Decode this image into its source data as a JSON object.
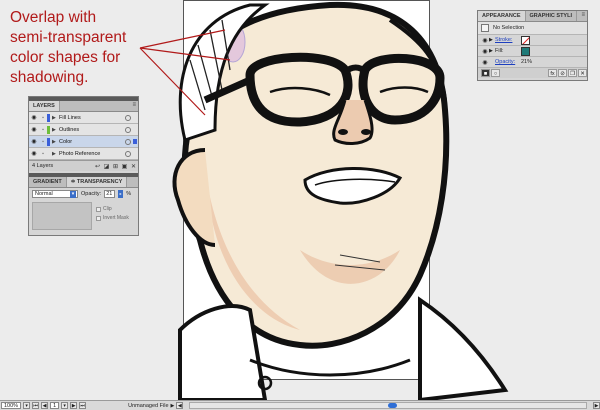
{
  "annotation": {
    "lines": [
      "Overlap with",
      "semi-transparent",
      "color shapes for",
      "shadowing."
    ],
    "color": "#b11a1a"
  },
  "layers_panel": {
    "tab": "LAYERS",
    "menu_icon": "panel-menu-icon",
    "layers": [
      {
        "name": "Fill Lines",
        "color": "#3a5fd9",
        "selected": false
      },
      {
        "name": "Outlines",
        "color": "#6fbf3a",
        "selected": false
      },
      {
        "name": "Color",
        "color": "#3a5fd9",
        "selected": true
      },
      {
        "name": "Photo Reference",
        "color": "#e4e4e4",
        "selected": false
      }
    ],
    "footer_label": "4 Layers"
  },
  "transparency_panel": {
    "tabs": [
      "GRADIENT",
      "≑ TRANSPARENCY"
    ],
    "blend_mode": "Normal",
    "opacity_label": "Opacity:",
    "opacity_value": "21",
    "percent": "%",
    "clip_label": "Clip",
    "invert_mask_label": "Invert Mask"
  },
  "appearance_panel": {
    "tabs": [
      "APPEARANCE",
      "GRAPHIC STYLI"
    ],
    "header": "No Selection",
    "stroke_label": "Stroke:",
    "fill_label": "Fill:",
    "fill_color": "#1f7a78",
    "opacity_label": "Opacity:",
    "opacity_value": "21%",
    "fx_label": "fx"
  },
  "statusbar": {
    "zoom": "100%",
    "page": "1",
    "status": "Unmanaged File"
  },
  "colors": {
    "selection_blue": "#c9d6ea",
    "accent_blue": "#2f6fd6"
  }
}
